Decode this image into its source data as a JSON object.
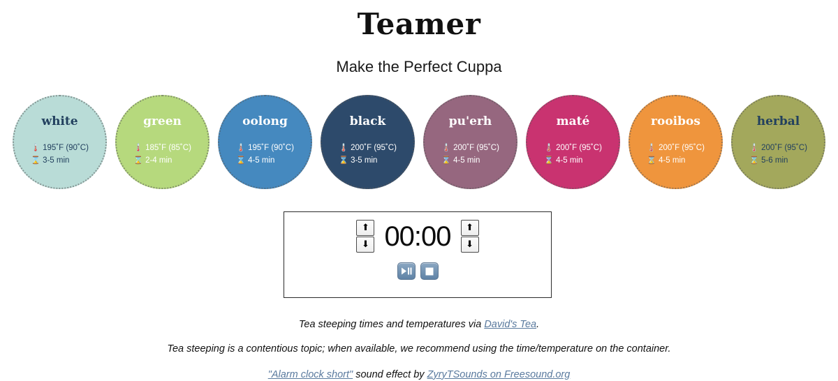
{
  "header": {
    "title": "Teamer",
    "subtitle": "Make the Perfect Cuppa"
  },
  "teas": [
    {
      "name": "white",
      "bg": "#b9dcd7",
      "text": "#22405e",
      "temp": "195˚F (90˚C)",
      "time": "3-5 min",
      "temp_icon": "🌡️",
      "time_icon": "⌛"
    },
    {
      "name": "green",
      "bg": "#b6d97d",
      "text": "#ffffff",
      "temp": "185˚F (85˚C)",
      "time": "2-4 min",
      "temp_icon": "🌡️",
      "time_icon": "⌛"
    },
    {
      "name": "oolong",
      "bg": "#4589bf",
      "text": "#ffffff",
      "temp": "195˚F (90˚C)",
      "time": "4-5 min",
      "temp_icon": "🌡️",
      "time_icon": "⌛"
    },
    {
      "name": "black",
      "bg": "#2d4a6b",
      "text": "#ffffff",
      "temp": "200˚F (95˚C)",
      "time": "3-5 min",
      "temp_icon": "🌡️",
      "time_icon": "⌛"
    },
    {
      "name": "pu'erh",
      "bg": "#96677f",
      "text": "#ffffff",
      "temp": "200˚F (95˚C)",
      "time": "4-5 min",
      "temp_icon": "🌡️",
      "time_icon": "⌛"
    },
    {
      "name": "maté",
      "bg": "#c93370",
      "text": "#ffffff",
      "temp": "200˚F (95˚C)",
      "time": "4-5 min",
      "temp_icon": "🌡️",
      "time_icon": "⌛"
    },
    {
      "name": "rooibos",
      "bg": "#ef953d",
      "text": "#ffffff",
      "temp": "200˚F (95˚C)",
      "time": "4-5 min",
      "temp_icon": "🌡️",
      "time_icon": "⌛"
    },
    {
      "name": "herbal",
      "bg": "#a3a85c",
      "text": "#22405e",
      "temp": "200˚F (95˚C)",
      "time": "5-6 min",
      "temp_icon": "🌡️",
      "time_icon": "⌛"
    }
  ],
  "timer": {
    "value": "00:00",
    "minutes_up": "⬆",
    "minutes_down": "⬇",
    "seconds_up": "⬆",
    "seconds_down": "⬇",
    "play_pause_label": "play-pause",
    "stop_label": "stop"
  },
  "footer": {
    "line1_before": "Tea steeping times and temperatures via ",
    "line1_link": "David's Tea",
    "line1_after": ".",
    "line2": "Tea steeping is a contentious topic; when available, we recommend using the time/temperature on the container.",
    "line3_link1": "\"Alarm clock short\"",
    "line3_middle": " sound effect by ",
    "line3_link2": "ZyryTSounds on Freesound.org"
  }
}
